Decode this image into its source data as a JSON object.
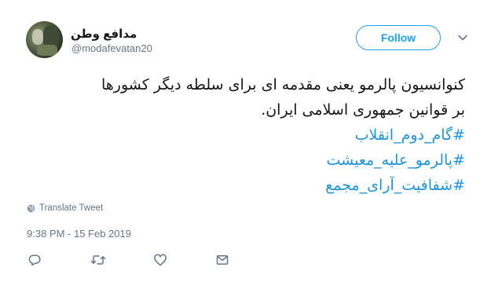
{
  "tweet": {
    "author": {
      "display_name": "مدافع وطن",
      "handle": "@modafevatan20"
    },
    "follow_label": "Follow",
    "text_lines": [
      "کنوانسیون پالرمو یعنی مقدمه ای برای سلطه دیگر کشورها",
      "بر قوانین جمهوری اسلامی ایران."
    ],
    "hashtags": [
      "#گام_دوم_انقلاب",
      "#پالرمو_علیه_معیشت",
      "#شفافیت_آرای_مجمع"
    ],
    "translate_label": "Translate Tweet",
    "timestamp": "9:38 PM - 15 Feb 2019",
    "actions": [
      "reply-icon",
      "retweet-icon",
      "like-icon",
      "direct-message-icon"
    ],
    "colors": {
      "accent": "#1da1f2",
      "hashtag": "#1b95e0",
      "secondary_text": "#657786",
      "primary_text": "#14171a"
    }
  }
}
